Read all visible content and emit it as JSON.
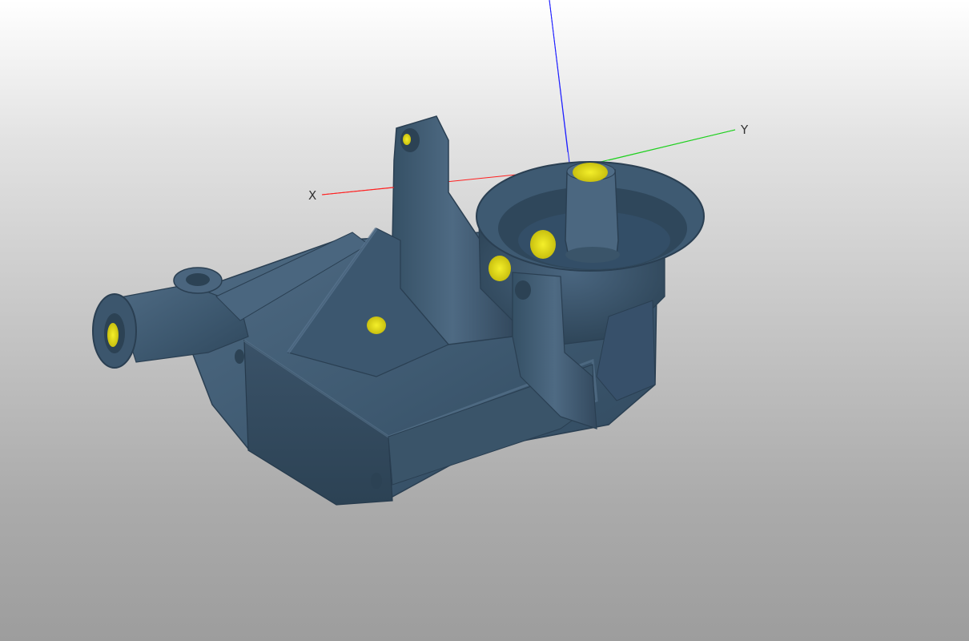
{
  "viewport": {
    "background_top": "#ffffff",
    "background_bottom": "#9d9d9d"
  },
  "axes": {
    "x": {
      "label": "X",
      "color": "#ff2020"
    },
    "y": {
      "label": "Y",
      "color": "#20d020"
    },
    "z": {
      "label": "",
      "color": "#2020ff"
    }
  },
  "model": {
    "surface_color": "#3f5a72",
    "deviation_highlight_color": "#e6e21a"
  }
}
